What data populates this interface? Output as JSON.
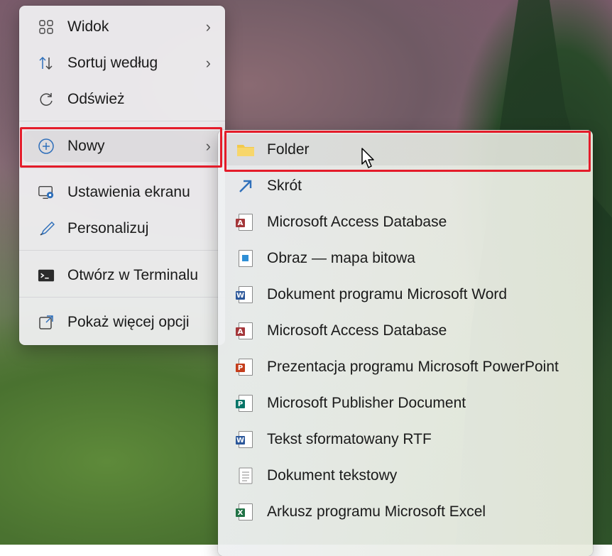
{
  "main_menu": {
    "items": [
      {
        "label": "Widok",
        "icon": "grid-view-icon",
        "has_submenu": true
      },
      {
        "label": "Sortuj według",
        "icon": "sort-arrows-icon",
        "has_submenu": true
      },
      {
        "label": "Odśwież",
        "icon": "refresh-icon",
        "has_submenu": false
      },
      {
        "label": "Nowy",
        "icon": "plus-circle-icon",
        "has_submenu": true
      },
      {
        "label": "Ustawienia ekranu",
        "icon": "display-settings-icon",
        "has_submenu": false
      },
      {
        "label": "Personalizuj",
        "icon": "brush-icon",
        "has_submenu": false
      },
      {
        "label": "Otwórz w Terminalu",
        "icon": "terminal-icon",
        "has_submenu": false
      },
      {
        "label": "Pokaż więcej opcji",
        "icon": "more-options-icon",
        "has_submenu": false
      }
    ]
  },
  "sub_menu": {
    "items": [
      {
        "label": "Folder",
        "icon": "folder-icon"
      },
      {
        "label": "Skrót",
        "icon": "shortcut-icon"
      },
      {
        "label": "Microsoft Access Database",
        "icon": "access-icon"
      },
      {
        "label": "Obraz — mapa bitowa",
        "icon": "bitmap-icon"
      },
      {
        "label": "Dokument programu Microsoft Word",
        "icon": "word-icon"
      },
      {
        "label": "Microsoft Access Database",
        "icon": "access-icon"
      },
      {
        "label": "Prezentacja programu Microsoft PowerPoint",
        "icon": "powerpoint-icon"
      },
      {
        "label": "Microsoft Publisher Document",
        "icon": "publisher-icon"
      },
      {
        "label": "Tekst sformatowany RTF",
        "icon": "rtf-icon"
      },
      {
        "label": "Dokument tekstowy",
        "icon": "text-document-icon"
      },
      {
        "label": "Arkusz programu Microsoft Excel",
        "icon": "excel-icon"
      }
    ]
  },
  "colors": {
    "highlight_border": "#e41c2a",
    "access": "#a4373a",
    "word": "#2b579a",
    "powerpoint": "#c43e1c",
    "publisher": "#077568",
    "excel": "#217346",
    "folder": "#f2c94c"
  }
}
